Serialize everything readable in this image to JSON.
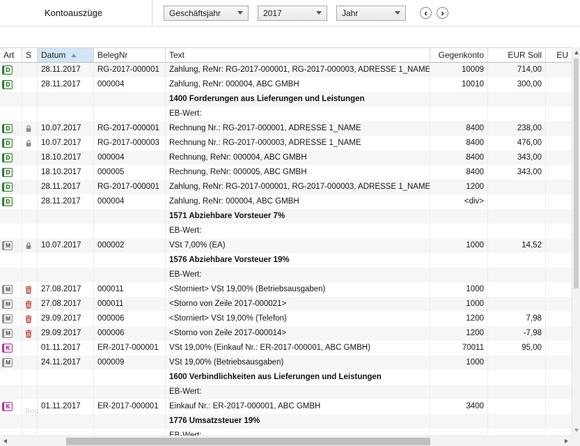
{
  "window": {
    "watermark": "Bog"
  },
  "toolbar": {
    "title": "Kontoauszüge",
    "dropdowns": [
      {
        "value": "Geschäftsjahr"
      },
      {
        "value": "2017"
      },
      {
        "value": "Jahr"
      }
    ],
    "prev_label": "‹",
    "next_label": "›"
  },
  "colors": {
    "art_d": {
      "border": "#2e7d32",
      "bg": "#e8f5e4",
      "fg": "#1b5e20"
    },
    "art_m": {
      "border": "#8a8a8a",
      "bg": "#f2f2f2",
      "fg": "#4a4a4a"
    },
    "art_k": {
      "border": "#b0379f",
      "bg": "#f9e4f6",
      "fg": "#8e2b80"
    },
    "datum_header_bg": "#d2e6f7",
    "lock": "#8c8c8c",
    "trash": "#c1514e"
  },
  "table": {
    "columns": [
      {
        "key": "art",
        "label": "Art"
      },
      {
        "key": "s",
        "label": "S"
      },
      {
        "key": "datum",
        "label": "Datum",
        "sorted": "asc"
      },
      {
        "key": "beleg",
        "label": "BelegNr"
      },
      {
        "key": "text",
        "label": "Text"
      },
      {
        "key": "gegen",
        "label": "Gegenkonto"
      },
      {
        "key": "soll",
        "label": "EUR Soll"
      },
      {
        "key": "haben",
        "label": "EU"
      }
    ],
    "rows": [
      {
        "type": "data",
        "art": "D",
        "s": "",
        "datum": "28.11.2017",
        "beleg": "RG-2017-000001",
        "text": "Zahlung, ReNr: RG-2017-000001, RG-2017-000003, ADRESSE 1_NAME",
        "gegen": "10009",
        "soll": "714,00"
      },
      {
        "type": "data",
        "art": "D",
        "s": "",
        "datum": "28.11.2017",
        "beleg": "000004",
        "text": "Zahlung, ReNr: 000004, ABC GMBH",
        "gegen": "10010",
        "soll": "300,00"
      },
      {
        "type": "group",
        "text": "1400 Forderungen aus Lieferungen und Leistungen"
      },
      {
        "type": "eb",
        "text": "EB-Wert:"
      },
      {
        "type": "data",
        "art": "D",
        "s": "lock",
        "datum": "10.07.2017",
        "beleg": "RG-2017-000001",
        "text": "Rechnung Nr.: RG-2017-000001, ADRESSE 1_NAME",
        "gegen": "8400",
        "soll": "238,00"
      },
      {
        "type": "data",
        "art": "D",
        "s": "lock",
        "datum": "10.07.2017",
        "beleg": "RG-2017-000003",
        "text": "Rechnung Nr.: RG-2017-000003, ADRESSE 1_NAME",
        "gegen": "8400",
        "soll": "476,00"
      },
      {
        "type": "data",
        "art": "D",
        "s": "",
        "datum": "18.10.2017",
        "beleg": "000004",
        "text": "Rechnung, ReNr: 000004, ABC GMBH",
        "gegen": "8400",
        "soll": "343,00"
      },
      {
        "type": "data",
        "art": "D",
        "s": "",
        "datum": "18.10.2017",
        "beleg": "000005",
        "text": "Rechnung, ReNr: 000005, ABC GMBH",
        "gegen": "8400",
        "soll": "343,00"
      },
      {
        "type": "data",
        "art": "D",
        "s": "",
        "datum": "28.11.2017",
        "beleg": "RG-2017-000001",
        "text": "Zahlung, ReNr: RG-2017-000001, RG-2017-000003, ADRESSE 1_NAME",
        "gegen": "1200",
        "soll": ""
      },
      {
        "type": "data",
        "art": "D",
        "s": "",
        "datum": "28.11.2017",
        "beleg": "000004",
        "text": "Zahlung, ReNr: 000004, ABC GMBH",
        "gegen": "<div>",
        "soll": ""
      },
      {
        "type": "group",
        "text": "1571 Abziehbare Vorsteuer 7%"
      },
      {
        "type": "eb",
        "text": "EB-Wert:"
      },
      {
        "type": "data",
        "art": "M",
        "s": "lock",
        "datum": "10.07.2017",
        "beleg": "000002",
        "text": "VSt 7,00% (EA)",
        "gegen": "1000",
        "soll": "14,52"
      },
      {
        "type": "group",
        "text": "1576 Abziehbare Vorsteuer 19%"
      },
      {
        "type": "eb",
        "text": "EB-Wert:"
      },
      {
        "type": "data",
        "art": "M",
        "s": "trash",
        "datum": "27.08.2017",
        "beleg": "000011",
        "text": "<Storniert> VSt 19,00% (Betriebsausgaben)",
        "gegen": "1000",
        "soll": ""
      },
      {
        "type": "data",
        "art": "M",
        "s": "trash",
        "datum": "27.08.2017",
        "beleg": "000011",
        "text": "<Storno von Zeile 2017-000021>",
        "gegen": "1000",
        "soll": ""
      },
      {
        "type": "data",
        "art": "M",
        "s": "trash",
        "datum": "29.09.2017",
        "beleg": "000006",
        "text": "<Storniert> VSt 19,00% (Telefon)",
        "gegen": "1200",
        "soll": "7,98"
      },
      {
        "type": "data",
        "art": "M",
        "s": "trash",
        "datum": "29.09.2017",
        "beleg": "000006",
        "text": "<Storno von Zeile 2017-000014>",
        "gegen": "1200",
        "soll": "-7,98"
      },
      {
        "type": "data",
        "art": "K",
        "s": "",
        "datum": "01.11.2017",
        "beleg": "ER-2017-000001",
        "text": "VSt 19,00% (Einkauf Nr.: ER-2017-000001, ABC GMBH)",
        "gegen": "70011",
        "soll": "95,00"
      },
      {
        "type": "data",
        "art": "M",
        "s": "",
        "datum": "24.11.2017",
        "beleg": "000009",
        "text": "VSt 19,00% (Betriebsausgaben)",
        "gegen": "1000",
        "soll": ""
      },
      {
        "type": "group",
        "text": "1600 Verbindlichkeiten aus Lieferungen und Leistungen"
      },
      {
        "type": "eb",
        "text": "EB-Wert:"
      },
      {
        "type": "data",
        "art": "K",
        "s": "",
        "datum": "01.11.2017",
        "beleg": "ER-2017-000001",
        "text": "Einkauf Nr.: ER-2017-000001, ABC GMBH",
        "gegen": "3400",
        "soll": ""
      },
      {
        "type": "group",
        "text": "1776 Umsatzsteuer 19%"
      },
      {
        "type": "eb",
        "text": "EB-Wert:"
      }
    ]
  }
}
